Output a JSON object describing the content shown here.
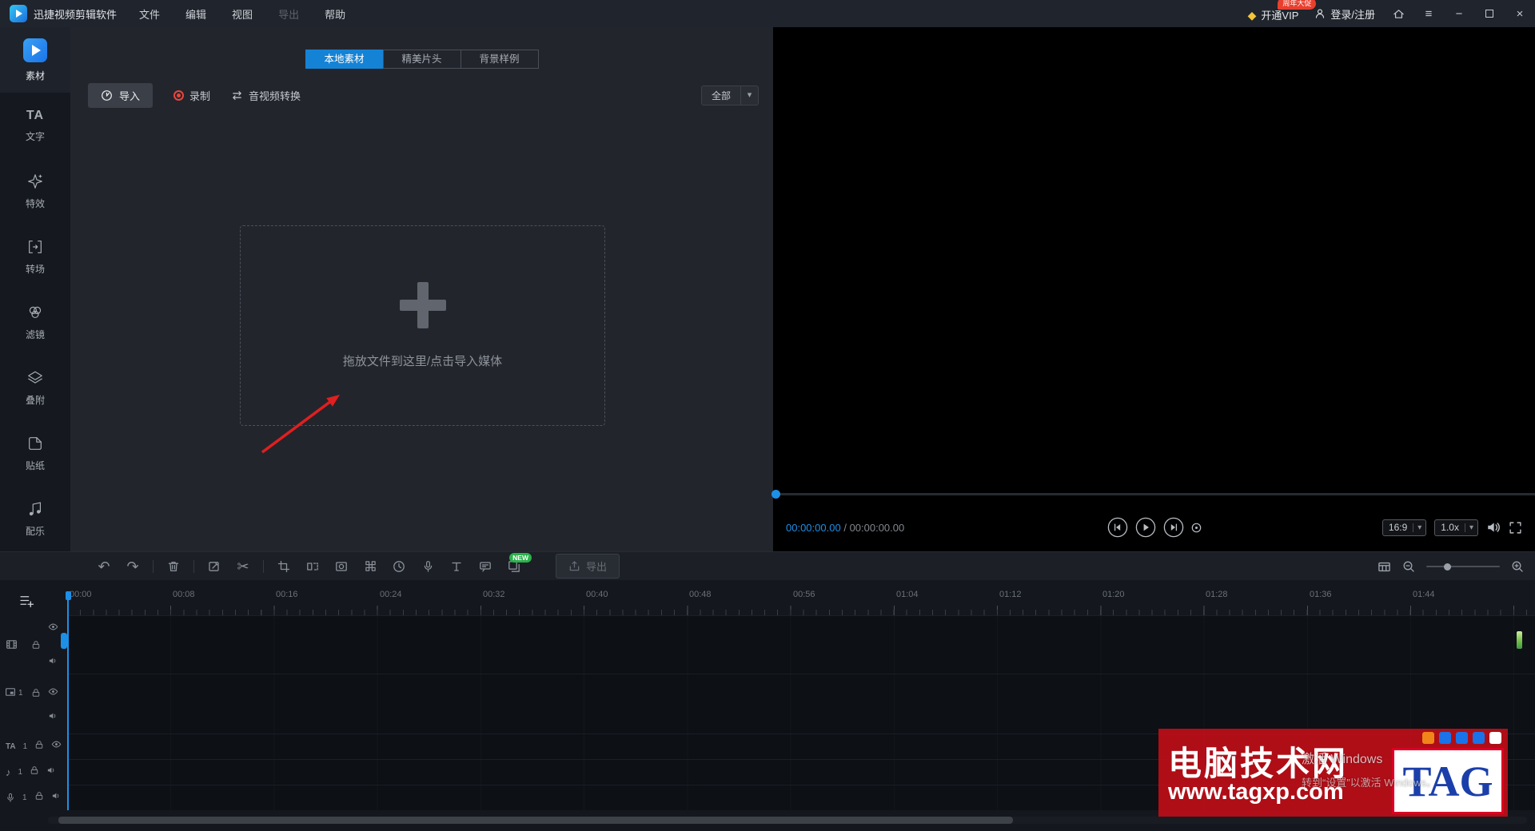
{
  "titlebar": {
    "app_name": "迅捷视频剪辑软件",
    "menus": [
      "文件",
      "编辑",
      "视图",
      "导出",
      "帮助"
    ],
    "vip_label": "开通VIP",
    "vip_badge": "周年大促",
    "login_label": "登录/注册"
  },
  "sidebar": {
    "items": [
      {
        "label": "素材"
      },
      {
        "label": "文字",
        "glyph": "TA"
      },
      {
        "label": "特效"
      },
      {
        "label": "转场"
      },
      {
        "label": "滤镜"
      },
      {
        "label": "叠附"
      },
      {
        "label": "贴纸"
      },
      {
        "label": "配乐"
      }
    ]
  },
  "material_panel": {
    "tabs": [
      "本地素材",
      "精美片头",
      "背景样例"
    ],
    "import_label": "导入",
    "record_label": "录制",
    "convert_label": "音视频转换",
    "filter_value": "全部",
    "dropzone_hint": "拖放文件到这里/点击导入媒体"
  },
  "preview": {
    "current_time": "00:00:00.00",
    "time_separator": "/",
    "total_time": "00:00:00.00",
    "aspect_ratio": "16:9",
    "speed": "1.0x"
  },
  "toolbar": {
    "export_label": "导出",
    "new_badge": "NEW"
  },
  "timeline": {
    "ruler_labels": [
      "00:00",
      "00:08",
      "00:16",
      "00:24",
      "00:32",
      "00:40",
      "00:48",
      "00:56",
      "01:04",
      "01:12",
      "01:20",
      "01:28",
      "01:36",
      "01:44"
    ],
    "tracks": [
      {},
      {
        "number": "1"
      },
      {
        "number": "1",
        "glyph": "TA"
      },
      {
        "number": "1",
        "glyph": "♪"
      },
      {
        "number": "1"
      }
    ]
  },
  "icons": {
    "undo": "↶",
    "redo": "↷",
    "scissors": "✂",
    "dropdown": "▾",
    "diamond": "◆",
    "hamburger": "≡",
    "minimize": "−",
    "close": "×"
  },
  "watermark": {
    "site_name": "电脑技术网",
    "site_url": "www.tagxp.com",
    "logo_text": "TAG"
  },
  "system_overlay": {
    "line1": "激活 Windows",
    "line2": "转到“设置”以激活 Windows。"
  }
}
